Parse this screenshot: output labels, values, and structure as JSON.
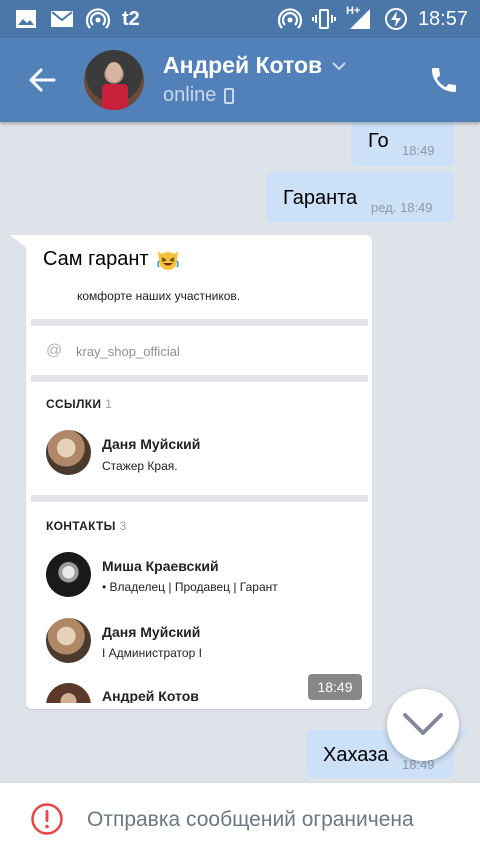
{
  "statusbar": {
    "carrier": "t2",
    "network": "H+",
    "time": "18:57"
  },
  "header": {
    "name": "Андрей Котов",
    "presence": "online"
  },
  "messages": {
    "m1": {
      "text": "Го",
      "time": "18:49"
    },
    "m2": {
      "text": "Гаранта",
      "time": "ред. 18:49"
    },
    "m3": {
      "text": "Сам гарант",
      "emoji": "laughing-cat-emoji",
      "time": "18:49",
      "embed": {
        "line1": "комфорте наших участников.",
        "at_symbol": "@",
        "handle": "kray_shop_official",
        "links_title": "ССЫЛКИ",
        "links_count": "1",
        "links": [
          {
            "name": "Даня Муйский",
            "sub": "Стажер Края."
          }
        ],
        "contacts_title": "КОНТАКТЫ",
        "contacts_count": "3",
        "contacts": [
          {
            "name": "Миша Краевский",
            "sub": "• Владелец | Продавец | Гарант"
          },
          {
            "name": "Даня Муйский",
            "sub": "I Администратор I"
          },
          {
            "name": "Андрей Котов",
            "sub": ""
          }
        ]
      }
    },
    "m4": {
      "text": "Хахаза",
      "time": "18:49"
    }
  },
  "bottom": {
    "notice": "Отправка сообщений ограничена"
  },
  "colors": {
    "header": "#5181b8",
    "statusbar": "#4a76a8",
    "outgoing": "#cce0f8",
    "background": "#dee3e9",
    "warning": "#e64646"
  }
}
